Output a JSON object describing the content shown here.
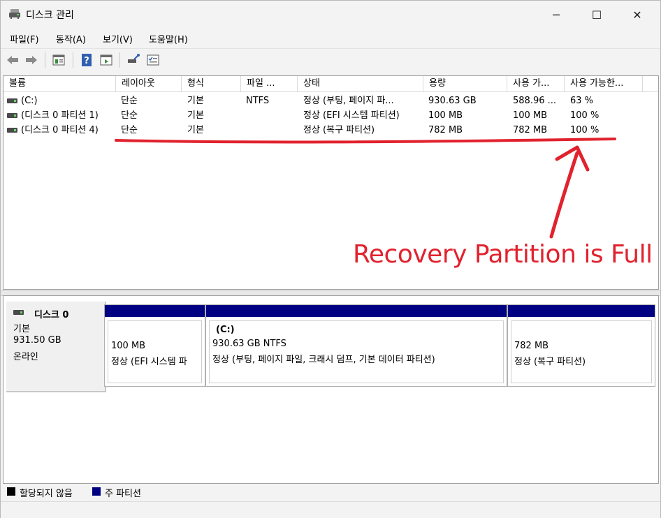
{
  "window": {
    "title": "디스크 관리",
    "controls": {
      "minimize": "─",
      "maximize": "☐",
      "close": "✕"
    }
  },
  "menu": [
    "파일(F)",
    "동작(A)",
    "보기(V)",
    "도움말(H)"
  ],
  "toolbar_icons": [
    "back-arrow-icon",
    "forward-arrow-icon",
    "properties-icon",
    "help-icon",
    "view-icon",
    "connect-icon",
    "checklist-icon"
  ],
  "volume_table": {
    "columns": [
      "볼륨",
      "레이아웃",
      "형식",
      "파일 ...",
      "상태",
      "용량",
      "사용 가...",
      "사용 가능한..."
    ],
    "rows": [
      {
        "volume": "(C:)",
        "layout": "단순",
        "type": "기본",
        "fs": "NTFS",
        "status": "정상 (부팅, 페이지 파...",
        "capacity": "930.63 GB",
        "free": "588.96 ...",
        "pct": "63 %"
      },
      {
        "volume": "(디스크 0 파티션 1)",
        "layout": "단순",
        "type": "기본",
        "fs": "",
        "status": "정상 (EFI 시스템 파티션)",
        "capacity": "100 MB",
        "free": "100 MB",
        "pct": "100 %"
      },
      {
        "volume": "(디스크 0 파티션 4)",
        "layout": "단순",
        "type": "기본",
        "fs": "",
        "status": "정상 (복구 파티션)",
        "capacity": "782 MB",
        "free": "782 MB",
        "pct": "100 %"
      }
    ]
  },
  "disk": {
    "name": "디스크 0",
    "type": "기본",
    "size": "931.50 GB",
    "state": "온라인",
    "partitions": [
      {
        "label": "",
        "size": "100 MB",
        "status": "정상 (EFI 시스템 파"
      },
      {
        "label": "(C:)",
        "size": "930.63 GB NTFS",
        "status": "정상 (부팅, 페이지 파일, 크래시 덤프, 기본 데이터 파티션)"
      },
      {
        "label": "",
        "size": "782 MB",
        "status": "정상 (복구 파티션)"
      }
    ]
  },
  "legend": [
    {
      "label": "할당되지 않음",
      "color": "#000000"
    },
    {
      "label": "주 파티션",
      "color": "#000082"
    }
  ],
  "annotation": {
    "text": "Recovery Partition is Full",
    "color": "#e1222e"
  }
}
